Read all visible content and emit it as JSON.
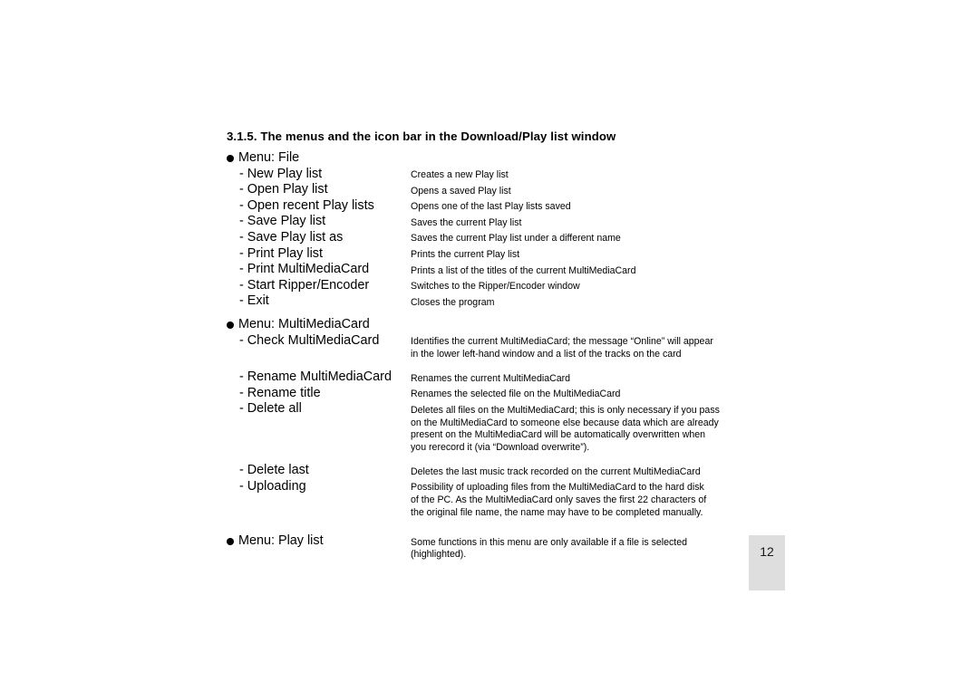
{
  "page": {
    "heading": "3.1.5. The menus and the icon bar in the Download/Play list window",
    "page_number": "12",
    "page_box_color": "#dedede"
  },
  "groups": [
    {
      "label": "Menu: File",
      "description": [],
      "items": [
        {
          "label": "- New Play list",
          "desc": [
            "Creates a new Play list"
          ]
        },
        {
          "label": "- Open Play list",
          "desc": [
            "Opens a saved Play list"
          ]
        },
        {
          "label": "- Open recent Play lists",
          "desc": [
            "Opens one of the last Play lists saved"
          ]
        },
        {
          "label": "- Save Play list",
          "desc": [
            "Saves the current Play list"
          ]
        },
        {
          "label": "- Save Play list as",
          "desc": [
            "Saves the current Play list under a different name"
          ]
        },
        {
          "label": "- Print Play list",
          "desc": [
            "Prints the current Play list"
          ]
        },
        {
          "label": "- Print MultiMediaCard",
          "desc": [
            "Prints a list of the titles of the current MultiMediaCard"
          ]
        },
        {
          "label": "- Start Ripper/Encoder",
          "desc": [
            "Switches to the Ripper/Encoder window"
          ]
        },
        {
          "label": "- Exit",
          "desc": [
            "Closes the program"
          ]
        }
      ]
    },
    {
      "label": "Menu: MultiMediaCard",
      "description": [],
      "items": [
        {
          "label": "- Check MultiMediaCard",
          "desc": [
            "Identifies the current MultiMediaCard; the message “Online” will appear",
            "in the lower left-hand window and a list of the tracks on the card"
          ]
        },
        {
          "label": "- Rename MultiMediaCard",
          "desc": [
            "Renames the current MultiMediaCard"
          ]
        },
        {
          "label": "- Rename title",
          "desc": [
            "Renames the selected file on the MultiMediaCard"
          ]
        },
        {
          "label": "- Delete all",
          "desc": [
            "Deletes all files on the MultiMediaCard; this is only necessary if you pass",
            "on the MultiMediaCard to someone else because data which are already",
            "present on the MultiMediaCard will be automatically overwritten when",
            "you rerecord it (via “Download overwrite”)."
          ]
        },
        {
          "label": "- Delete last",
          "desc": [
            "Deletes the last music track recorded on the current MultiMediaCard"
          ]
        },
        {
          "label": "- Uploading",
          "desc": [
            "Possibility of uploading files from the MultiMediaCard to the hard disk",
            "of the PC. As the MultiMediaCard only saves the first 22 characters of",
            "the original file name, the name may have to be completed manually."
          ]
        }
      ]
    },
    {
      "label": "Menu: Play list",
      "description": [
        "Some functions in this menu are only available if a file is selected",
        "(highlighted)."
      ],
      "items": []
    }
  ]
}
